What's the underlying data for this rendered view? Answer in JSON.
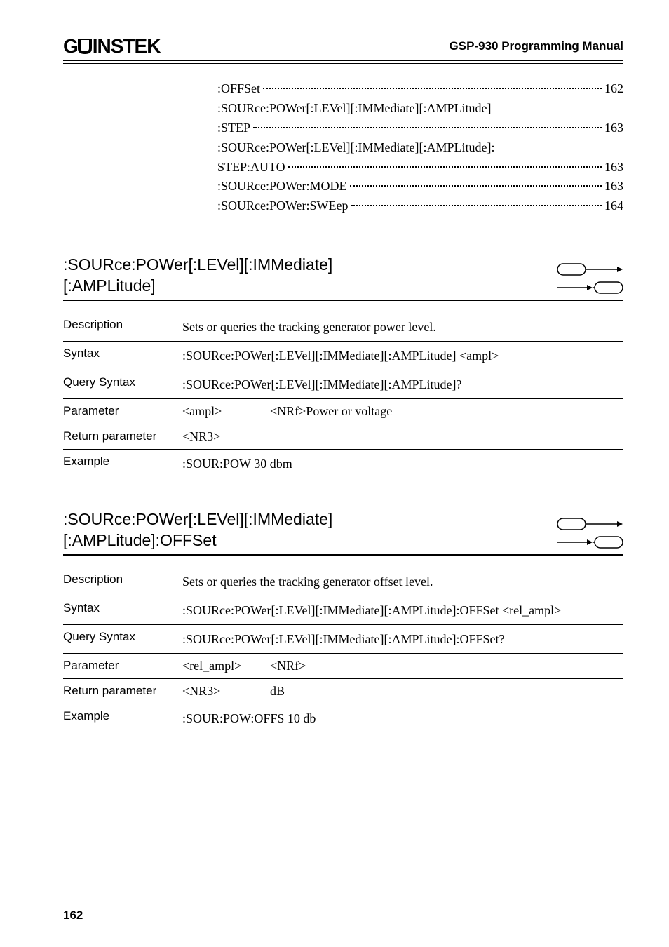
{
  "header": {
    "logo_prefix": "G",
    "logo_suffix": "INSTEK",
    "title": "GSP-930 Programming Manual"
  },
  "toc": [
    {
      "text": ":OFFSet",
      "page": "162",
      "dots": true
    },
    {
      "text": ":SOURce:POWer[:LEVel][:IMMediate][:AMPLitude]",
      "page": "",
      "dots": false
    },
    {
      "text": ":STEP ",
      "page": "163",
      "dots": true
    },
    {
      "text": ":SOURce:POWer[:LEVel][:IMMediate][:AMPLitude]:",
      "page": "",
      "dots": false
    },
    {
      "text": "STEP:AUTO ",
      "page": "163",
      "dots": true
    },
    {
      "text": ":SOURce:POWer:MODE ",
      "page": "163",
      "dots": true
    },
    {
      "text": ":SOURce:POWer:SWEep",
      "page": "164",
      "dots": true
    }
  ],
  "sections": [
    {
      "title_line1": ":SOURce:POWer[:LEVel][:IMMediate]",
      "title_line2": "[:AMPLitude]",
      "rows": [
        {
          "type": "simple",
          "label": "Description",
          "value": "Sets or queries the tracking generator power level."
        },
        {
          "type": "simple",
          "label": "Syntax",
          "value": ":SOURce:POWer[:LEVel][:IMMediate][:AMPLitude] <ampl>"
        },
        {
          "type": "simple",
          "label": "Query Syntax",
          "value": ":SOURce:POWer[:LEVel][:IMMediate][:AMPLitude]?"
        },
        {
          "type": "param",
          "label": "Parameter",
          "col1": "<ampl>",
          "col2": "<NRf>Power or voltage"
        },
        {
          "type": "param",
          "label": "Return parameter",
          "col1": "<NR3>",
          "col2": ""
        },
        {
          "type": "simple",
          "label": "Example",
          "value": ":SOUR:POW 30 dbm"
        }
      ]
    },
    {
      "title_line1": ":SOURce:POWer[:LEVel][:IMMediate]",
      "title_line2": "[:AMPLitude]:OFFSet",
      "rows": [
        {
          "type": "simple",
          "label": "Description",
          "value": "Sets or queries the tracking generator offset level."
        },
        {
          "type": "simple",
          "label": "Syntax",
          "value": ":SOURce:POWer[:LEVel][:IMMediate][:AMPLitude]:OFFSet <rel_ampl>"
        },
        {
          "type": "simple",
          "label": "Query Syntax",
          "value": ":SOURce:POWer[:LEVel][:IMMediate][:AMPLitude]:OFFSet?"
        },
        {
          "type": "param",
          "label": "Parameter",
          "col1": "<rel_ampl>",
          "col2": "<NRf>"
        },
        {
          "type": "param",
          "label": "Return parameter",
          "col1": "<NR3>",
          "col2": "dB"
        },
        {
          "type": "simple",
          "label": "Example",
          "value": ":SOUR:POW:OFFS 10 db"
        }
      ]
    }
  ],
  "page_number": "162"
}
